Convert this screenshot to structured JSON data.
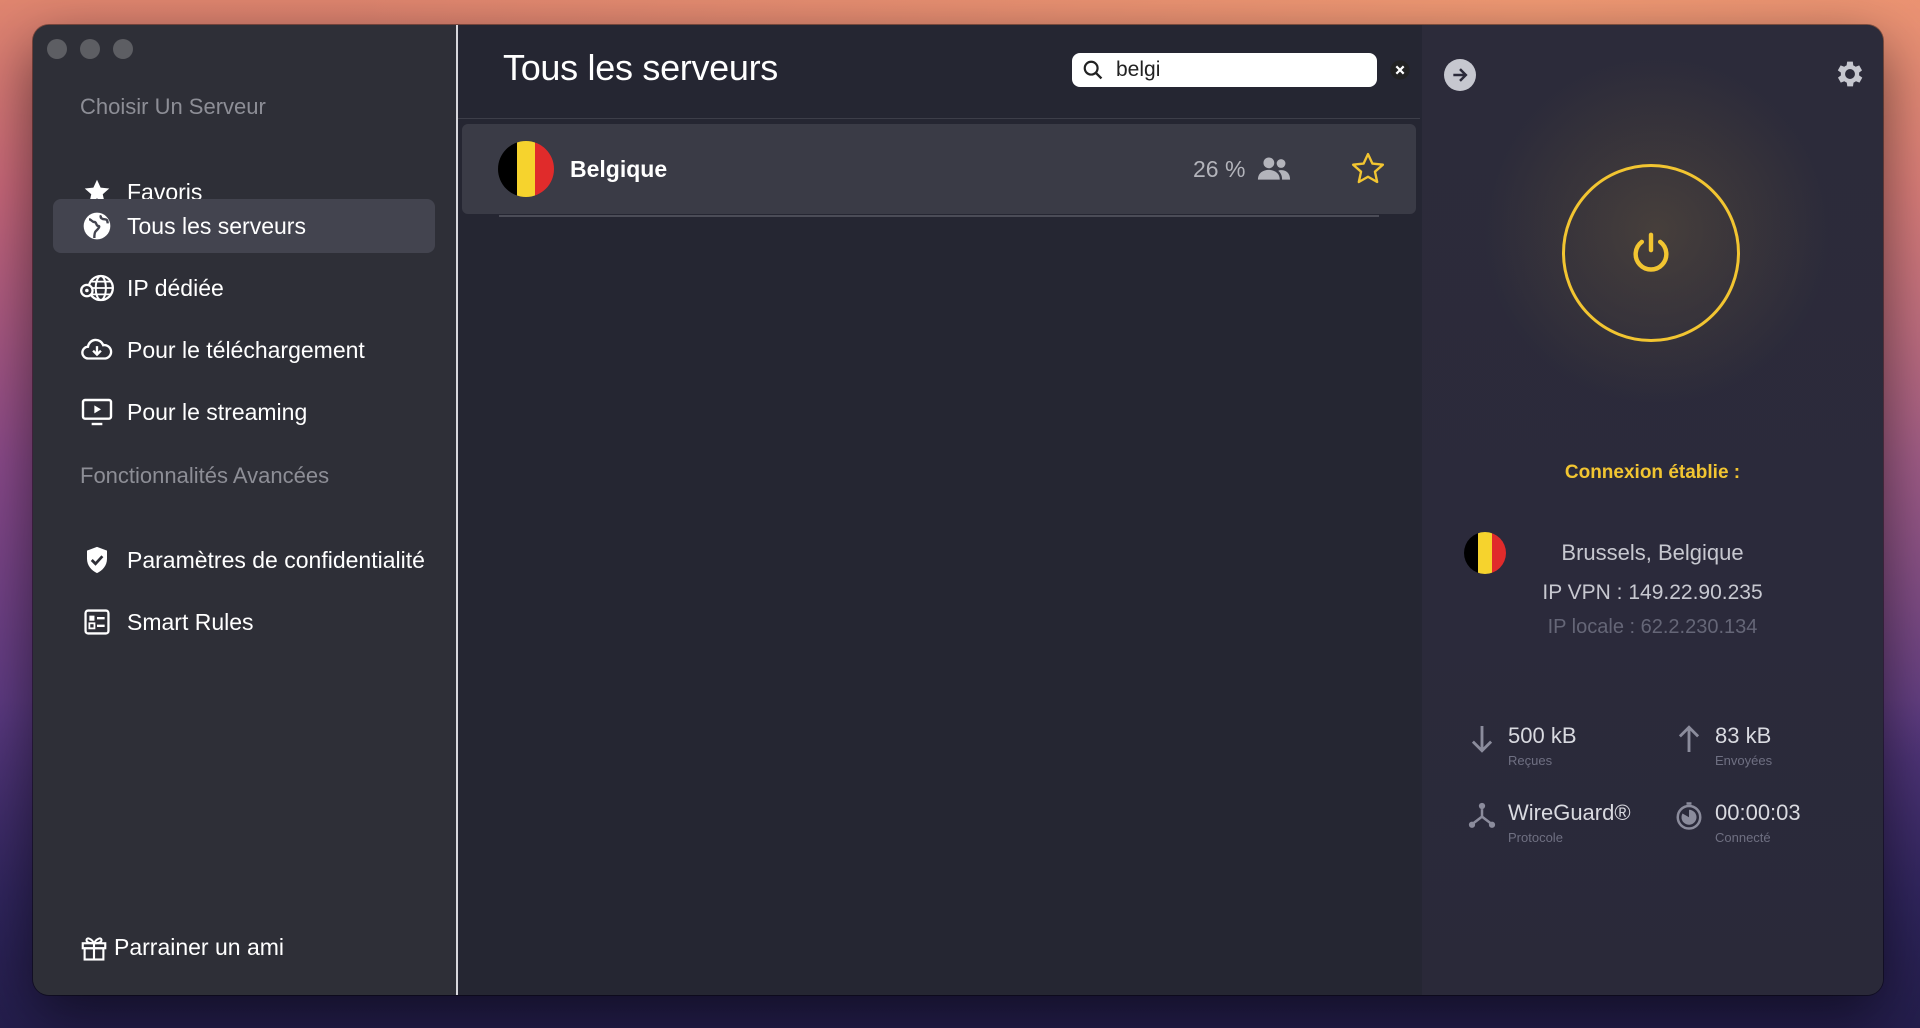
{
  "sidebar": {
    "section_choose": "Choisir Un Serveur",
    "section_advanced": "Fonctionnalités Avancées",
    "items": [
      {
        "label": "Favoris",
        "icon": "star-icon"
      },
      {
        "label": "Tous les serveurs",
        "icon": "globe-icon",
        "active": true
      },
      {
        "label": "IP dédiée",
        "icon": "dedicated-ip-globe-icon"
      },
      {
        "label": "Pour le téléchargement",
        "icon": "cloud-download-icon"
      },
      {
        "label": "Pour le streaming",
        "icon": "play-screen-icon"
      }
    ],
    "advanced_items": [
      {
        "label": "Paramètres de confidentialité",
        "icon": "shield-check-icon"
      },
      {
        "label": "Smart Rules",
        "icon": "rules-list-icon"
      }
    ],
    "referral_label": "Parrainer un ami"
  },
  "main": {
    "title": "Tous les serveurs",
    "search": {
      "value": "belgi",
      "placeholder": ""
    },
    "servers": [
      {
        "name": "Belgique",
        "load": "26 %",
        "favorite": false,
        "flag_colors": [
          "#000000",
          "#f6d32d",
          "#e02b2b"
        ]
      }
    ]
  },
  "connection": {
    "status": "Connexion établie :",
    "location": "Brussels, Belgique",
    "vpn_ip": "IP VPN : 149.22.90.235",
    "local_ip": "IP locale : 62.2.230.134",
    "received": {
      "value": "500 kB",
      "label": "Reçues"
    },
    "sent": {
      "value": "83 kB",
      "label": "Envoyées"
    },
    "protocol": {
      "value": "WireGuard®",
      "label": "Protocole"
    },
    "duration": {
      "value": "00:00:03",
      "label": "Connecté"
    }
  },
  "colors": {
    "accent_yellow": "#f2c531",
    "sidebar_bg": "#2e2f37",
    "main_bg": "#252632",
    "active_item_bg": "#43444f"
  }
}
